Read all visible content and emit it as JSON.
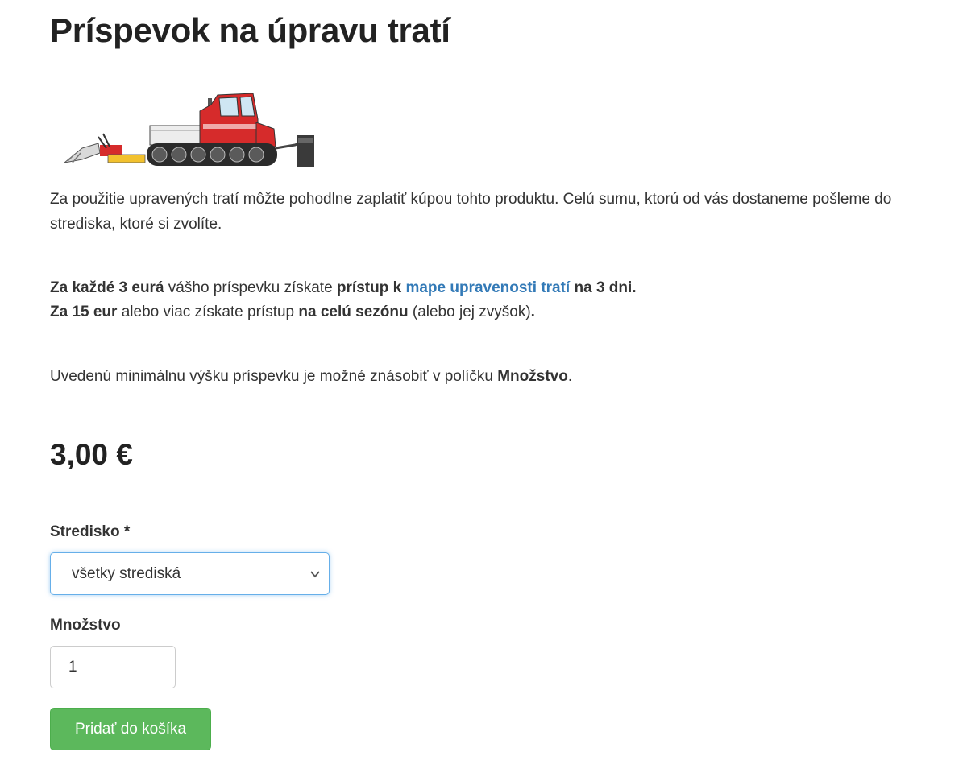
{
  "page": {
    "title": "Príspevok na úpravu tratí"
  },
  "image": {
    "icon": "snow-groomer-illustration",
    "colors": {
      "body": "#d62b2b",
      "track": "#2b2b2b",
      "blade": "#f2c12e"
    }
  },
  "description": {
    "p1": "Za použitie upravených tratí môžte pohodlne zaplatiť kúpou tohto produktu. Celú sumu, ktorú od vás dostaneme pošleme do strediska, ktoré si zvolíte.",
    "p2_bold1": "Za každé 3 eurá",
    "p2_text1": " vášho príspevku získate ",
    "p2_bold2": "prístup k",
    "p2_space": " ",
    "p2_link": "mape upravenosti tratí",
    "p2_bold3": " na 3 dni.",
    "p3_bold1": "Za 15 eur",
    "p3_text1": " alebo viac získate prístup ",
    "p3_bold2": "na celú sezónu",
    "p3_text2": " (alebo jej zvyšok)",
    "p3_bold3": ".",
    "p4_text": "Uvedenú minimálnu výšku príspevku je možné znásobiť v políčku ",
    "p4_bold": "Množstvo",
    "p4_end": "."
  },
  "price": "3,00 €",
  "form": {
    "stredisko_label": "Stredisko *",
    "stredisko_selected": "všetky strediská",
    "mnozstvo_label": "Množstvo",
    "mnozstvo_value": "1",
    "add_to_cart_label": "Pridať do košíka"
  },
  "colors": {
    "link": "#337ab7",
    "button": "#5cb85c",
    "focus": "#66afe9"
  }
}
